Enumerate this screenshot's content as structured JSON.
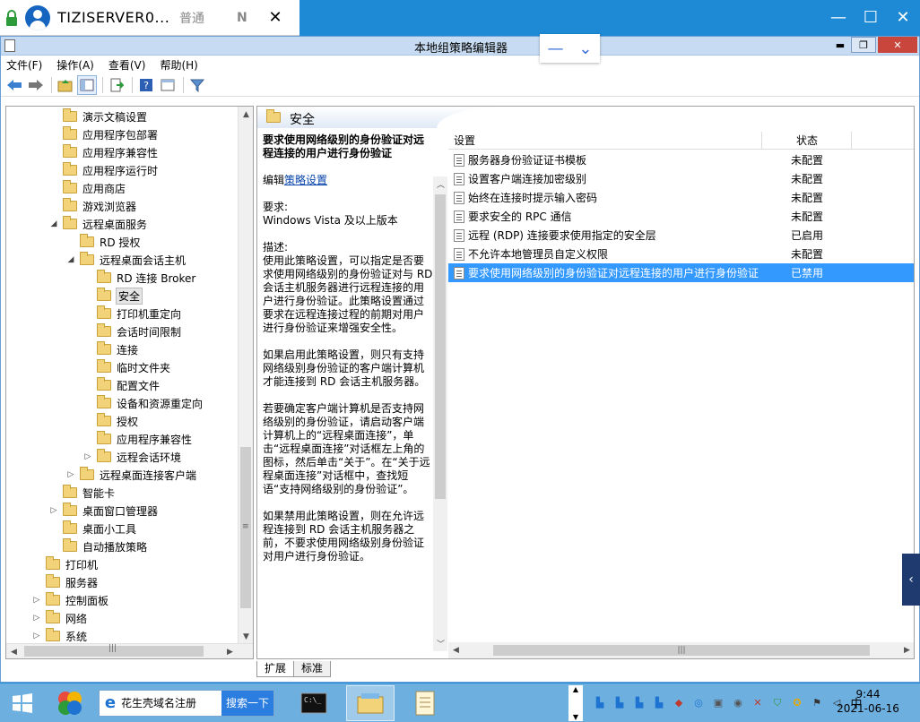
{
  "remote_bar": {
    "title": "TIZISERVER0...",
    "mode": "普通",
    "n": "N"
  },
  "window": {
    "title": "本地组策略编辑器"
  },
  "menu": [
    "文件(F)",
    "操作(A)",
    "查看(V)",
    "帮助(H)"
  ],
  "tree": {
    "items": [
      {
        "label": "演示文稿设置",
        "indent": 3,
        "exp": ""
      },
      {
        "label": "应用程序包部署",
        "indent": 3,
        "exp": ""
      },
      {
        "label": "应用程序兼容性",
        "indent": 3,
        "exp": ""
      },
      {
        "label": "应用程序运行时",
        "indent": 3,
        "exp": ""
      },
      {
        "label": "应用商店",
        "indent": 3,
        "exp": ""
      },
      {
        "label": "游戏浏览器",
        "indent": 3,
        "exp": ""
      },
      {
        "label": "远程桌面服务",
        "indent": 3,
        "exp": "◢"
      },
      {
        "label": "RD 授权",
        "indent": 4,
        "exp": ""
      },
      {
        "label": "远程桌面会话主机",
        "indent": 4,
        "exp": "◢"
      },
      {
        "label": "RD 连接 Broker",
        "indent": 5,
        "exp": ""
      },
      {
        "label": "安全",
        "indent": 5,
        "exp": "",
        "selected": true
      },
      {
        "label": "打印机重定向",
        "indent": 5,
        "exp": ""
      },
      {
        "label": "会话时间限制",
        "indent": 5,
        "exp": ""
      },
      {
        "label": "连接",
        "indent": 5,
        "exp": ""
      },
      {
        "label": "临时文件夹",
        "indent": 5,
        "exp": ""
      },
      {
        "label": "配置文件",
        "indent": 5,
        "exp": ""
      },
      {
        "label": "设备和资源重定向",
        "indent": 5,
        "exp": ""
      },
      {
        "label": "授权",
        "indent": 5,
        "exp": ""
      },
      {
        "label": "应用程序兼容性",
        "indent": 5,
        "exp": ""
      },
      {
        "label": "远程会话环境",
        "indent": 5,
        "exp": "▷"
      },
      {
        "label": "远程桌面连接客户端",
        "indent": 4,
        "exp": "▷"
      },
      {
        "label": "智能卡",
        "indent": 3,
        "exp": ""
      },
      {
        "label": "桌面窗口管理器",
        "indent": 3,
        "exp": "▷"
      },
      {
        "label": "桌面小工具",
        "indent": 3,
        "exp": ""
      },
      {
        "label": "自动播放策略",
        "indent": 3,
        "exp": ""
      },
      {
        "label": "打印机",
        "indent": 2,
        "exp": ""
      },
      {
        "label": "服务器",
        "indent": 2,
        "exp": ""
      },
      {
        "label": "控制面板",
        "indent": 2,
        "exp": "▷"
      },
      {
        "label": "网络",
        "indent": 2,
        "exp": "▷"
      },
      {
        "label": "系统",
        "indent": 2,
        "exp": "▷"
      }
    ]
  },
  "right_pane": {
    "header": "安全",
    "desc_title": "要求使用网络级别的身份验证对远程连接的用户进行身份验证",
    "edit_prefix": "编辑",
    "edit_link": "策略设置",
    "req_label": "要求:",
    "req_value": "Windows Vista 及以上版本",
    "desc_label": "描述:",
    "desc_p1": "使用此策略设置，可以指定是否要求使用网络级别的身份验证对与 RD 会话主机服务器进行远程连接的用户进行身份验证。此策略设置通过要求在远程连接过程的前期对用户进行身份验证来增强安全性。",
    "desc_p2": "如果启用此策略设置，则只有支持网络级别身份验证的客户端计算机才能连接到 RD 会话主机服务器。",
    "desc_p3": "若要确定客户端计算机是否支持网络级别的身份验证，请启动客户端计算机上的“远程桌面连接”，单击“远程桌面连接”对话框左上角的图标，然后单击“关于”。在“关于远程桌面连接”对话框中，查找短语“支持网络级别的身份验证”。",
    "desc_p4": "如果禁用此策略设置，则在允许远程连接到 RD 会话主机服务器之前，不要求使用网络级别身份验证对用户进行身份验证。",
    "columns": {
      "setting": "设置",
      "status": "状态"
    },
    "rows": [
      {
        "name": "服务器身份验证证书模板",
        "status": "未配置"
      },
      {
        "name": "设置客户端连接加密级别",
        "status": "未配置"
      },
      {
        "name": "始终在连接时提示输入密码",
        "status": "未配置"
      },
      {
        "name": "要求安全的 RPC 通信",
        "status": "未配置"
      },
      {
        "name": "远程 (RDP) 连接要求使用指定的安全层",
        "status": "已启用"
      },
      {
        "name": "不允许本地管理员自定义权限",
        "status": "未配置"
      },
      {
        "name": "要求使用网络级别的身份验证对远程连接的用户进行身份验证",
        "status": "已禁用",
        "selected": true
      }
    ],
    "tabs": [
      "扩展",
      "标准"
    ]
  },
  "taskbar": {
    "browser_text": "花生壳域名注册",
    "search_button": "搜索一下",
    "ime": "中",
    "time": "9:44",
    "date": "2021-06-16"
  }
}
